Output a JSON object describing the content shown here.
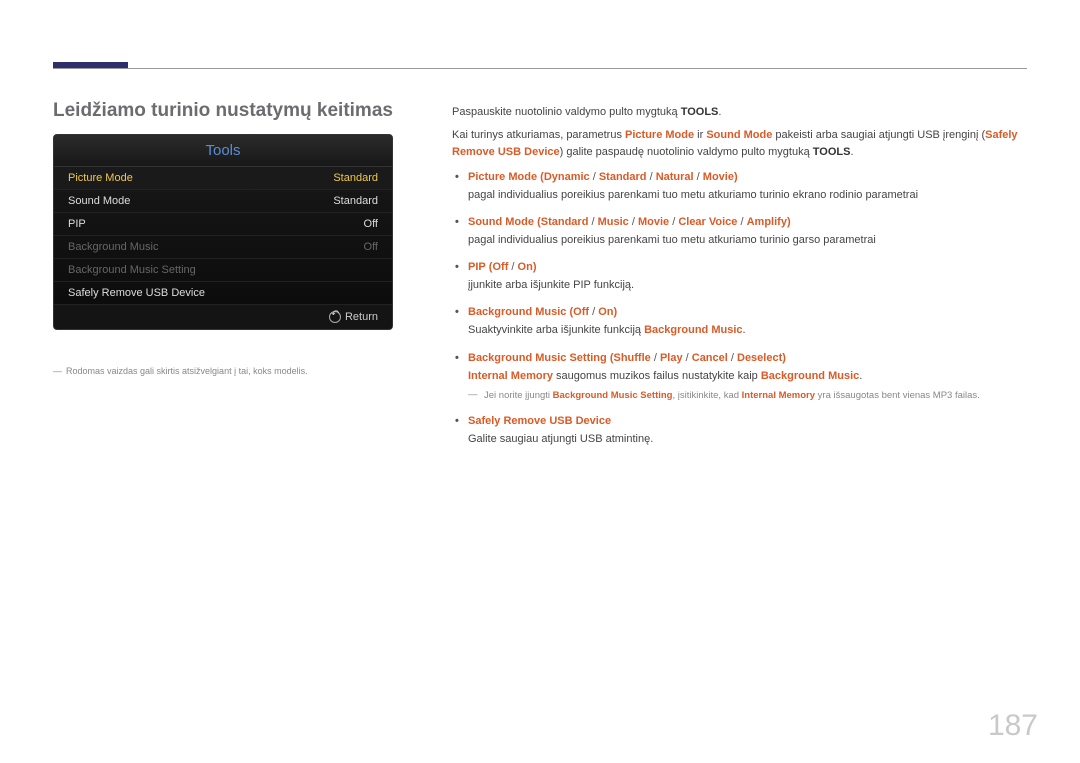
{
  "section_title": "Leidžiamo turinio nustatymų keitimas",
  "tools": {
    "header": "Tools",
    "rows": [
      {
        "label": "Picture Mode",
        "value": "Standard",
        "state": "selected"
      },
      {
        "label": "Sound Mode",
        "value": "Standard",
        "state": ""
      },
      {
        "label": "PIP",
        "value": "Off",
        "state": ""
      },
      {
        "label": "Background Music",
        "value": "Off",
        "state": "dim"
      },
      {
        "label": "Background Music Setting",
        "value": "",
        "state": "dim"
      },
      {
        "label": "Safely Remove USB Device",
        "value": "",
        "state": ""
      }
    ],
    "return_label": "Return"
  },
  "left_note": "Rodomas vaizdas gali skirtis atsižvelgiant į tai, koks modelis.",
  "intro": {
    "p1_a": "Paspauskite nuotolinio valdymo pulto mygtuką ",
    "p1_b": "TOOLS",
    "p1_c": ".",
    "p2_a": "Kai turinys atkuriamas, parametrus ",
    "p2_b": "Picture Mode",
    "p2_c": " ir ",
    "p2_d": "Sound Mode",
    "p2_e": " pakeisti arba saugiai atjungti USB įrenginį (",
    "p2_f": "Safely Remove USB Device",
    "p2_g": ") galite paspaudę nuotolinio valdymo pulto mygtuką ",
    "p2_h": "TOOLS",
    "p2_i": "."
  },
  "items": {
    "pic": {
      "name": "Picture Mode",
      "opts": [
        "Dynamic",
        "Standard",
        "Natural",
        "Movie"
      ],
      "desc": "pagal individualius poreikius parenkami tuo metu atkuriamo turinio ekrano rodinio parametrai"
    },
    "snd": {
      "name": "Sound Mode",
      "opts": [
        "Standard",
        "Music",
        "Movie",
        "Clear Voice",
        "Amplify"
      ],
      "desc": "pagal individualius poreikius parenkami tuo metu atkuriamo turinio garso parametrai"
    },
    "pip": {
      "name": "PIP",
      "opts": [
        "Off",
        "On"
      ],
      "desc": "įjunkite arba išjunkite PIP funkciją."
    },
    "bgm": {
      "name": "Background Music",
      "opts": [
        "Off",
        "On"
      ],
      "desc_a": "Suaktyvinkite arba išjunkite funkciją ",
      "desc_b": "Background Music",
      "desc_c": "."
    },
    "bgms": {
      "name": "Background Music Setting",
      "opts": [
        "Shuffle",
        "Play",
        "Cancel",
        "Deselect"
      ],
      "im_name": "Internal Memory",
      "im_rest": " saugomus muzikos failus nustatykite kaip ",
      "im_b": "Background Music",
      "im_c": "."
    },
    "note": {
      "a": "Jei norite įjungti ",
      "b": "Background Music Setting",
      "c": ", įsitikinkite, kad ",
      "d": "Internal Memory",
      "e": " yra išsaugotas bent vienas MP3 failas."
    },
    "safe": {
      "name": "Safely Remove USB Device",
      "desc": "Galite saugiau atjungti USB atmintinę."
    }
  },
  "page_number": "187"
}
